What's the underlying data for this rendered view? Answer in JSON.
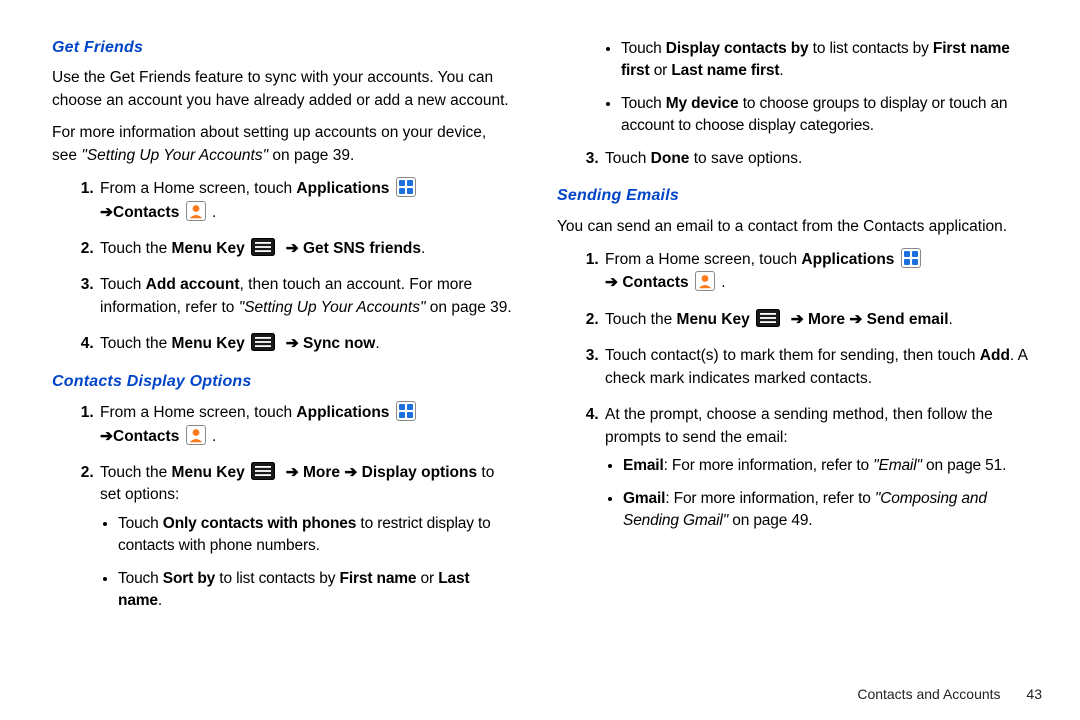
{
  "footer": {
    "section": "Contacts and Accounts",
    "page": "43"
  },
  "headings": {
    "get_friends": "Get Friends",
    "contacts_display": "Contacts Display Options",
    "sending_emails": "Sending Emails"
  },
  "glyphs": {
    "arrow": "➔"
  },
  "text": {
    "gf_intro": "Use the Get Friends feature to sync with your accounts. You can choose an account you have already added or add a new account.",
    "gf_more1": "For more information about setting up accounts on your device, see ",
    "gf_more_ref": "\"Setting Up Your Accounts\"",
    "gf_more2": " on page 39.",
    "from_home": "From a Home screen, touch ",
    "applications": "Applications",
    "contacts": "Contacts",
    "period_space": " .",
    "touch_the": "Touch the ",
    "menu_key": "Menu Key",
    "get_sns": "Get SNS friends",
    "touch": "Touch ",
    "add_account": "Add account",
    "gf3_tail1": ", then touch an account. For more information, refer to ",
    "gf3_ref": "\"Setting Up Your Accounts\"",
    "gf3_tail2": "  on page 39.",
    "sync_now": "Sync now",
    "more": "More",
    "display_options": "Display options",
    "cdo2_tail": " to set options:",
    "only_contacts": "Only contacts with phones",
    "cdo_b1_tail": " to restrict display to contacts with phone numbers.",
    "sort_by": "Sort by",
    "cdo_b2_mid": " to list contacts by ",
    "first_name": "First name",
    "or": " or ",
    "last_name": "Last name",
    "display_contacts_by": "Display contacts by",
    "cdo_b3_mid": " to list contacts by ",
    "first_name_first": "First name first",
    "last_name_first": "Last name first",
    "my_device": "My device",
    "cdo_b4_tail": " to choose groups to display or touch an account to choose display categories.",
    "done": "Done",
    "cdo3_tail": " to save options.",
    "se_intro": "You can send an email to a contact from the Contacts application.",
    "send_email": "Send email",
    "se3_a": "Touch contact(s) to mark them for sending, then touch ",
    "add": "Add",
    "se3_b": ". A check mark indicates marked contacts.",
    "se4": "At the prompt, choose a sending method, then follow the prompts to send the email:",
    "email": "Email",
    "se_b1_mid": ": For more information, refer to ",
    "email_ref": "\"Email\"",
    "se_b1_tail": "  on page 51.",
    "gmail": "Gmail",
    "se_b2_mid": ": For more information, refer to ",
    "gmail_ref": "\"Composing and Sending Gmail\"",
    "se_b2_tail": "  on page 49."
  }
}
